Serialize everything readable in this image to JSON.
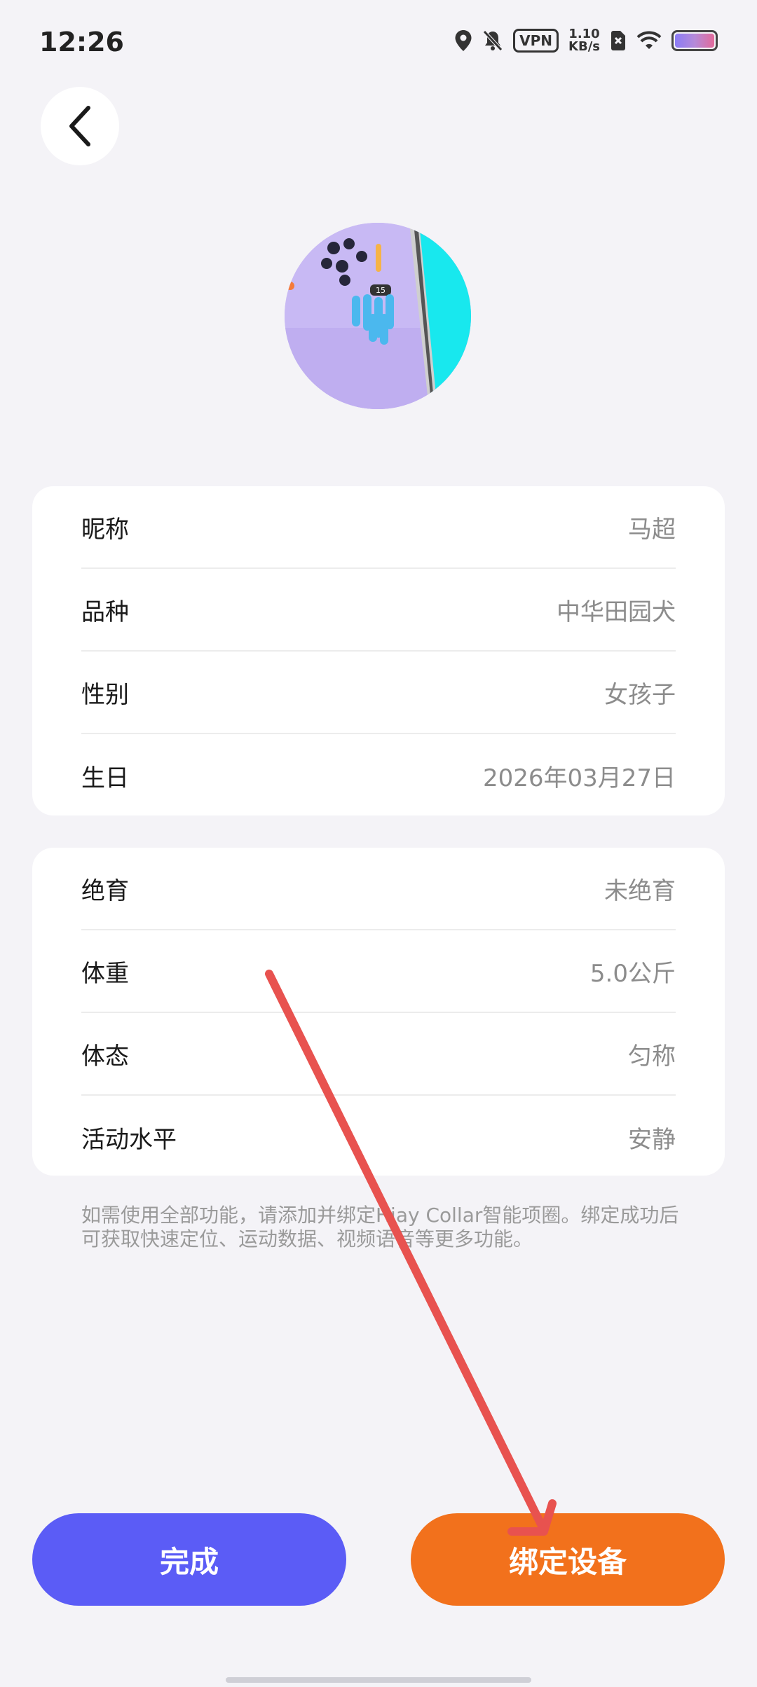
{
  "status_bar": {
    "time": "12:26",
    "vpn": "VPN",
    "speed_value": "1.10",
    "speed_unit": "KB/s"
  },
  "profile_card": {
    "rows": [
      {
        "label": "昵称",
        "value": "马超"
      },
      {
        "label": "品种",
        "value": "中华田园犬"
      },
      {
        "label": "性别",
        "value": "女孩子"
      },
      {
        "label": "生日",
        "value": "2026年03月27日"
      }
    ]
  },
  "health_card": {
    "rows": [
      {
        "label": "绝育",
        "value": "未绝育"
      },
      {
        "label": "体重",
        "value": "5.0公斤"
      },
      {
        "label": "体态",
        "value": "匀称"
      },
      {
        "label": "活动水平",
        "value": "安静"
      }
    ]
  },
  "hint": "如需使用全部功能，请添加并绑定Hiay Collar智能项圈。绑定成功后可获取快速定位、运动数据、视频语音等更多功能。",
  "avatar_badge": "15",
  "buttons": {
    "done": "完成",
    "bind": "绑定设备"
  },
  "colors": {
    "done_button": "#5b5cf6",
    "bind_button": "#f2711c",
    "annotation_arrow": "#e8524f"
  }
}
